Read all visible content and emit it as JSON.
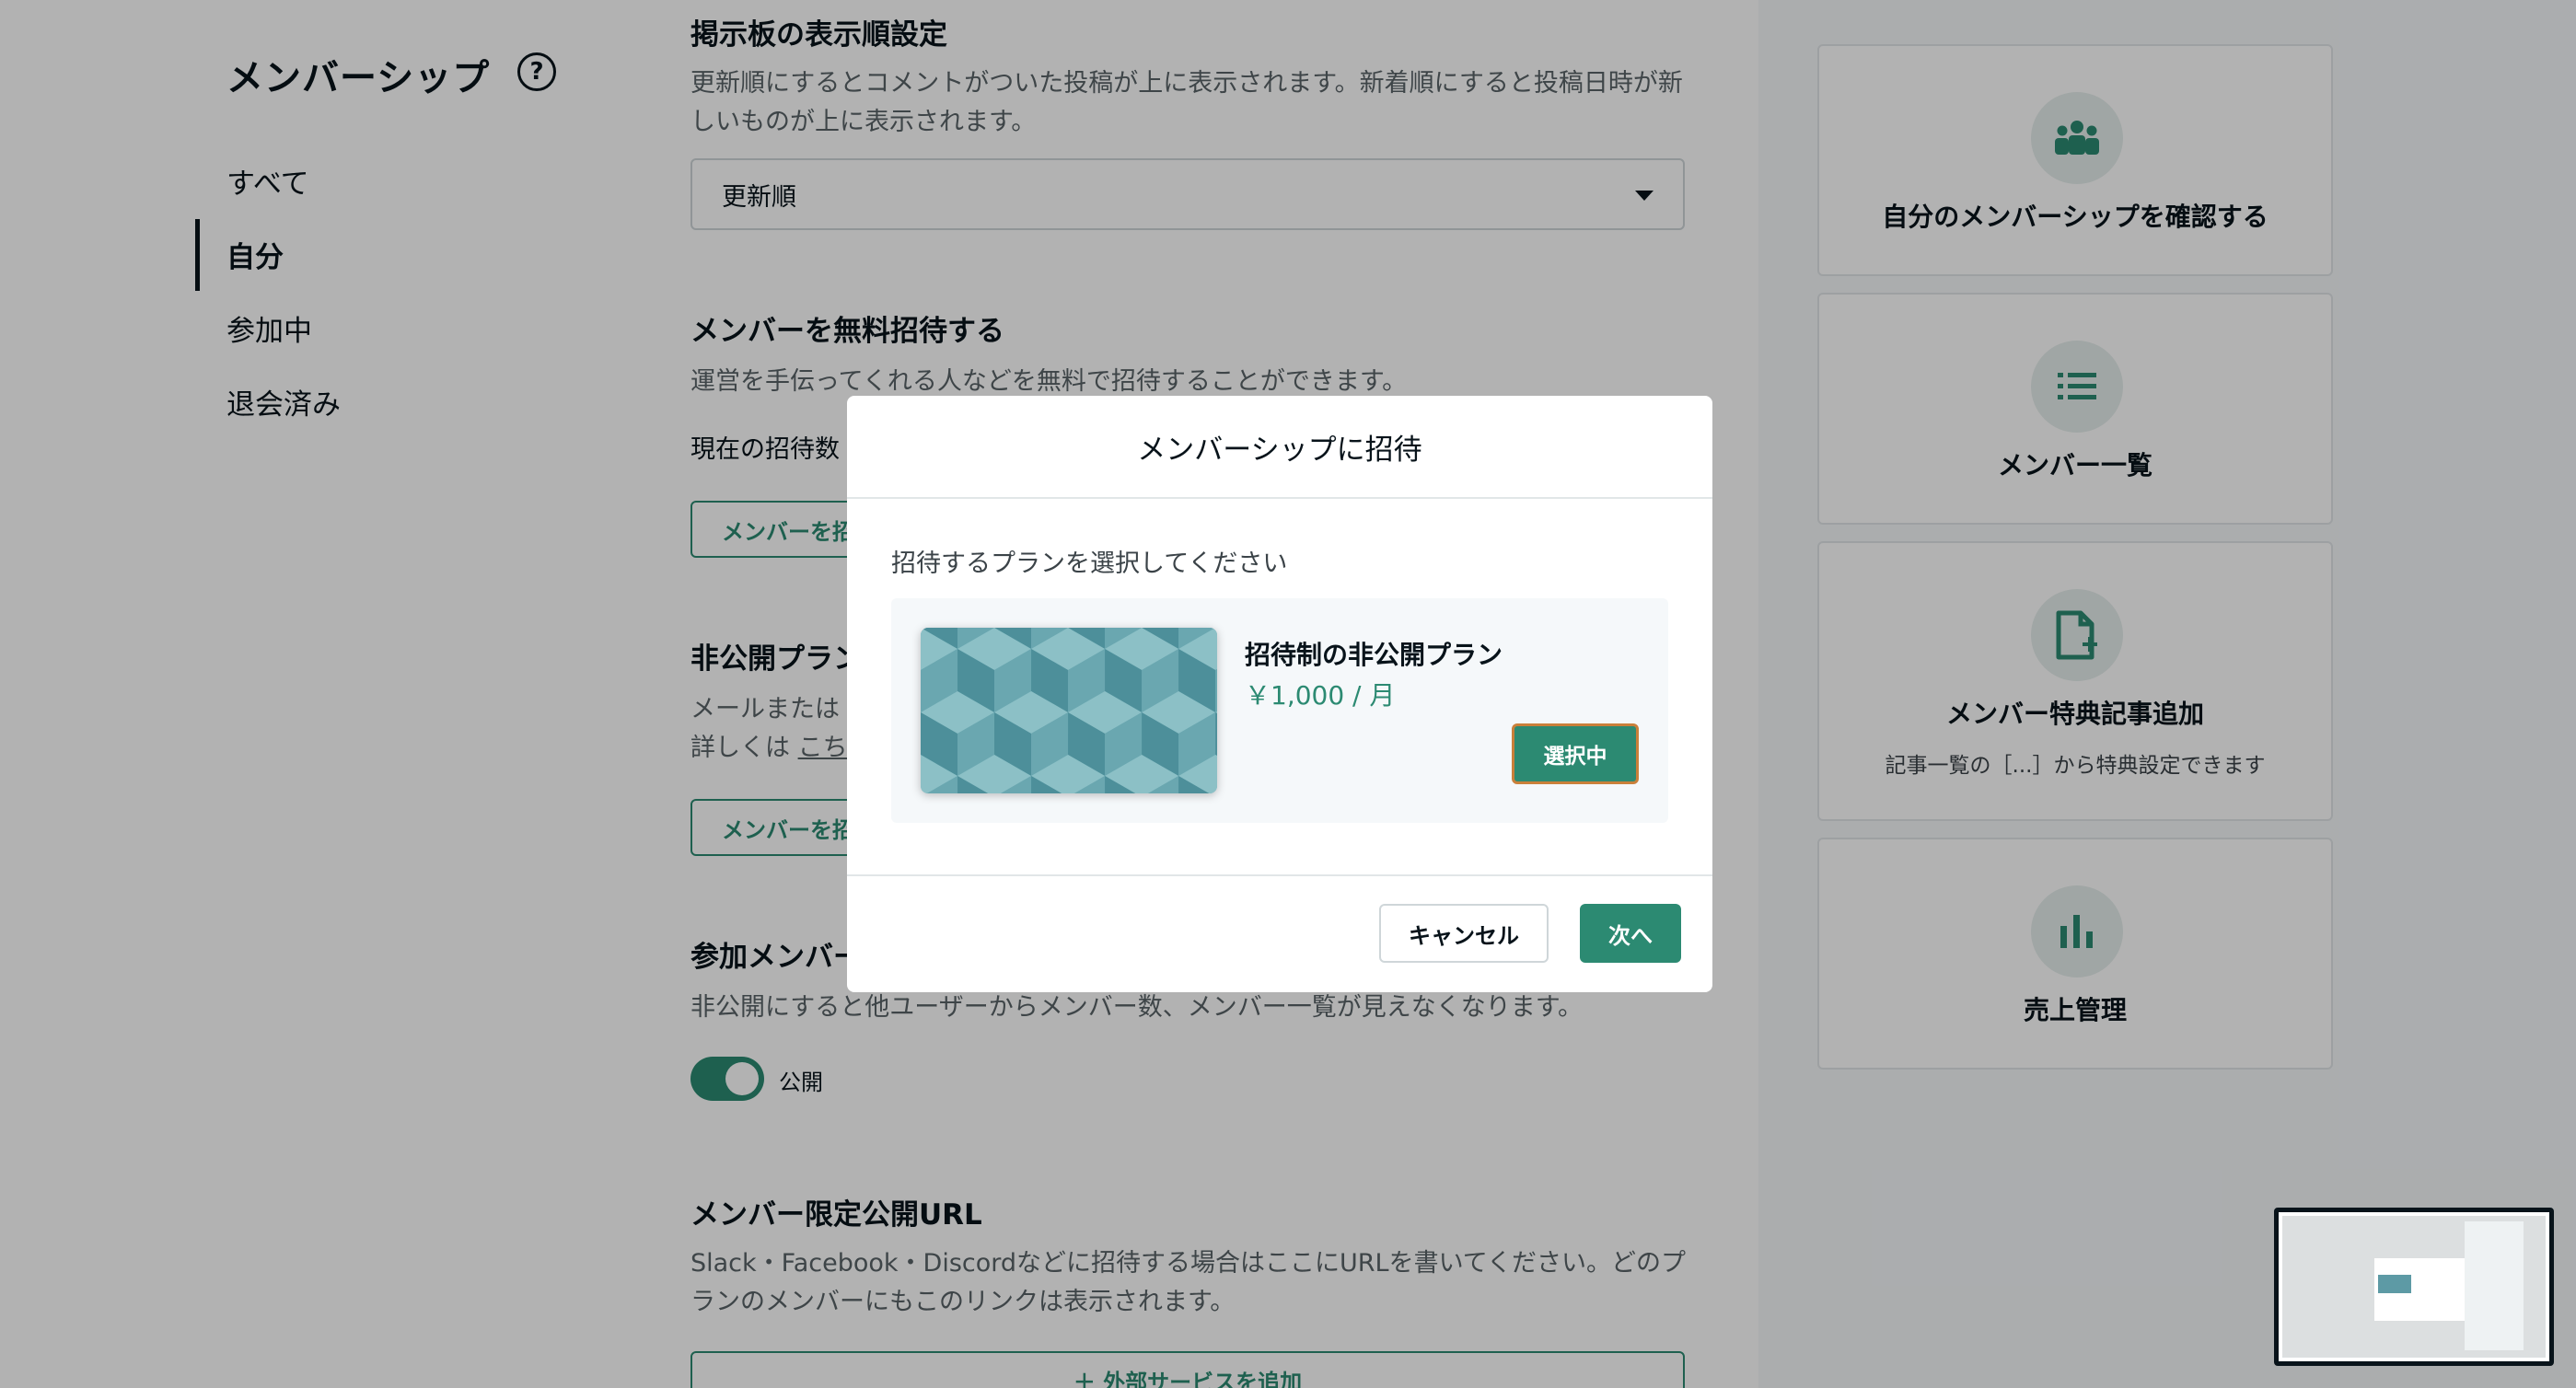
{
  "sidebar": {
    "title": "メンバーシップ",
    "help_icon": "question-circle-icon",
    "items": [
      {
        "label": "すべて",
        "active": false
      },
      {
        "label": "自分",
        "active": true
      },
      {
        "label": "参加中",
        "active": false
      },
      {
        "label": "退会済み",
        "active": false
      }
    ]
  },
  "main": {
    "board_order": {
      "heading": "掲示板の表示順設定",
      "description": "更新順にするとコメントがついた投稿が上に表示されます。新着順にすると投稿日時が新しいものが上に表示されます。",
      "select_value": "更新順"
    },
    "free_invite": {
      "heading": "メンバーを無料招待する",
      "description": "運営を手伝ってくれる人などを無料で招待することができます。",
      "current_label": "現在の招待数",
      "button": "メンバーを招待する"
    },
    "private_plan": {
      "heading": "非公開プラン",
      "description_1": "メールまたは",
      "description_2_prefix": "詳しくは",
      "link": "こちら",
      "button": "メンバーを招待する"
    },
    "members_visibility": {
      "heading": "参加メンバー",
      "description": "非公開にすると他ユーザーからメンバー数、メンバー一覧が見えなくなります。",
      "toggle_label": "公開",
      "toggle_on": true
    },
    "member_url": {
      "heading": "メンバー限定公開URL",
      "description": "Slack・Facebook・Discordなどに招待する場合はここにURLを書いてください。どのプランのメンバーにもこのリンクは表示されます。",
      "button": "＋ 外部サービスを追加"
    }
  },
  "right_cards": [
    {
      "title": "自分のメンバーシップを確認する",
      "icon": "group-icon"
    },
    {
      "title": "メンバー一覧",
      "icon": "list-icon"
    },
    {
      "title": "メンバー特典記事追加",
      "subtitle": "記事一覧の［...］から特典設定できます",
      "icon": "file-plus-icon"
    },
    {
      "title": "売上管理",
      "icon": "bar-chart-icon"
    }
  ],
  "modal": {
    "title": "メンバーシップに招待",
    "label": "招待するプランを選択してください",
    "plan": {
      "name": "招待制の非公開プラン",
      "price": "￥1,000 / 月",
      "select_button": "選択中"
    },
    "cancel_button": "キャンセル",
    "next_button": "次へ"
  },
  "colors": {
    "accent": "#2c8a72",
    "overlay": "rgba(0,0,0,0.3)",
    "text": "#08131a"
  }
}
